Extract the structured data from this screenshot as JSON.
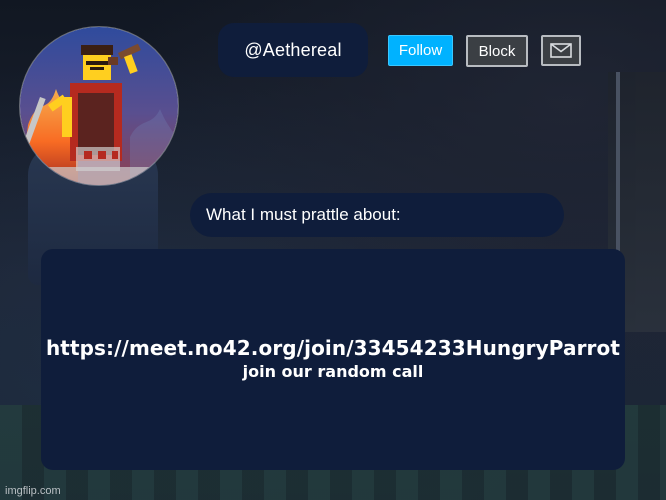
{
  "profile": {
    "handle": "@Aethereal"
  },
  "actions": {
    "follow_label": "Follow",
    "block_label": "Block",
    "message_icon": "mail-icon"
  },
  "prattle": {
    "label": "What I must prattle about:"
  },
  "content": {
    "url": "https://meet.no42.org/join/33454233HungryParrot",
    "message": "join our random call"
  },
  "footer": {
    "watermark": "imgflip.com"
  },
  "colors": {
    "panel": "#0f1d3b",
    "follow": "#00b2ff",
    "button_dark": "#3b3f44",
    "button_border": "#b8bcc1",
    "text": "#ffffff"
  }
}
